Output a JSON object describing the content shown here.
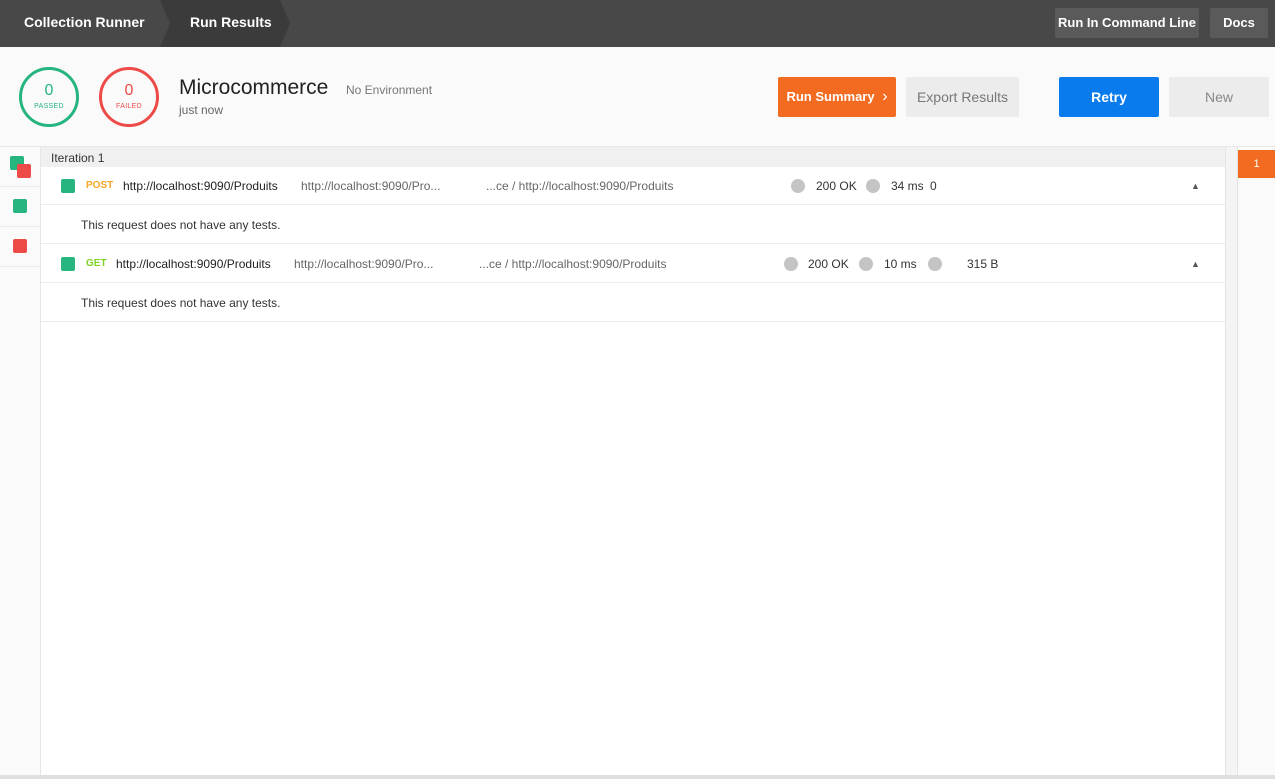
{
  "topbar": {
    "crumb_runner": "Collection Runner",
    "crumb_results": "Run Results",
    "run_command_line": "Run In Command Line",
    "docs": "Docs"
  },
  "summary": {
    "passed_count": "0",
    "passed_label": "PASSED",
    "failed_count": "0",
    "failed_label": "FAILED",
    "collection_name": "Microcommerce",
    "environment": "No Environment",
    "time": "just now",
    "run_summary": "Run Summary",
    "export_results": "Export Results",
    "retry": "Retry",
    "new": "New"
  },
  "iteration": {
    "title": "Iteration 1",
    "nav_label": "1"
  },
  "requests": [
    {
      "method": "POST",
      "name": "http://localhost:9090/Produits",
      "url": "http://localhost:9090/Pro...",
      "path": "...ce / http://localhost:9090/Produits",
      "status": "200 OK",
      "time": "34 ms",
      "size": "0",
      "tests_message": "This request does not have any tests."
    },
    {
      "method": "GET",
      "name": "http://localhost:9090/Produits",
      "url": "http://localhost:9090/Pro...",
      "path": "...ce / http://localhost:9090/Produits",
      "status": "200 OK",
      "time": "10 ms",
      "size": "315 B",
      "tests_message": "This request does not have any tests."
    }
  ],
  "icons": {
    "collapse": "caret-up-icon",
    "next": "chevron-right-icon",
    "status_pass": "green-square",
    "status_fail": "red-square"
  },
  "colors": {
    "passed": "#26b47f",
    "failed": "#ed4b48",
    "accent": "#f26b21",
    "primary": "#097bed"
  }
}
